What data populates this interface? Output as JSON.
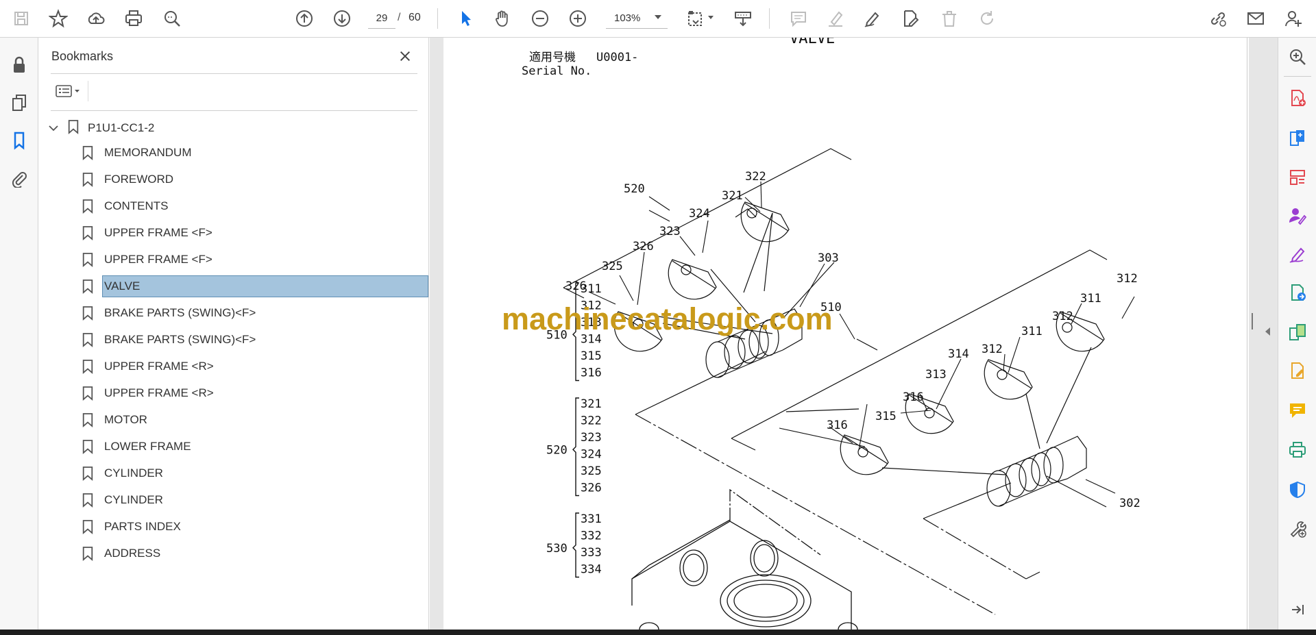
{
  "toolbar": {
    "current_page": "29",
    "page_separator": "/",
    "total_pages": "60",
    "zoom": "103%"
  },
  "bookmarks": {
    "title": "Bookmarks",
    "root": "P1U1-CC1-2",
    "items": [
      {
        "label": "MEMORANDUM",
        "selected": false
      },
      {
        "label": "FOREWORD",
        "selected": false
      },
      {
        "label": "CONTENTS",
        "selected": false
      },
      {
        "label": "UPPER FRAME <F>",
        "selected": false
      },
      {
        "label": "UPPER FRAME <F>",
        "selected": false
      },
      {
        "label": "VALVE",
        "selected": true
      },
      {
        "label": "BRAKE PARTS (SWING)<F>",
        "selected": false
      },
      {
        "label": "BRAKE PARTS (SWING)<F>",
        "selected": false
      },
      {
        "label": "UPPER FRAME <R>",
        "selected": false
      },
      {
        "label": "UPPER FRAME <R>",
        "selected": false
      },
      {
        "label": "MOTOR",
        "selected": false
      },
      {
        "label": "LOWER FRAME",
        "selected": false
      },
      {
        "label": "CYLINDER",
        "selected": false
      },
      {
        "label": "CYLINDER",
        "selected": false
      },
      {
        "label": "PARTS INDEX",
        "selected": false
      },
      {
        "label": "ADDRESS",
        "selected": false
      }
    ]
  },
  "document": {
    "heading": "VALVE",
    "serial_label_jp": "適用号機",
    "serial_label_en": "Serial No.",
    "serial_value": "U0001-",
    "watermark": "machinecatalogic.com",
    "groups": [
      {
        "id": "510",
        "parts": [
          "311",
          "312",
          "313",
          "314",
          "315",
          "316"
        ]
      },
      {
        "id": "520",
        "parts": [
          "321",
          "322",
          "323",
          "324",
          "325",
          "326"
        ]
      },
      {
        "id": "530",
        "parts": [
          "331",
          "332",
          "333",
          "334"
        ]
      }
    ],
    "callouts": {
      "c520": "520",
      "c321": "321",
      "c322": "322",
      "c323": "323",
      "c324": "324",
      "c325": "325",
      "c326a": "326",
      "c326b": "326",
      "c303": "303",
      "c510": "510",
      "c311a": "311",
      "c311b": "311",
      "c312a": "312",
      "c312b": "312",
      "c312c": "312",
      "c313": "313",
      "c314": "314",
      "c315": "315",
      "c316a": "316",
      "c316b": "316",
      "c302": "302"
    }
  },
  "colors": {
    "accent_blue": "#1473e6",
    "selection": "#a4c4dd",
    "watermark": "#c99a1a",
    "tool_red": "#e34850",
    "tool_purple": "#9b3dd1",
    "tool_green": "#2d9d78"
  }
}
